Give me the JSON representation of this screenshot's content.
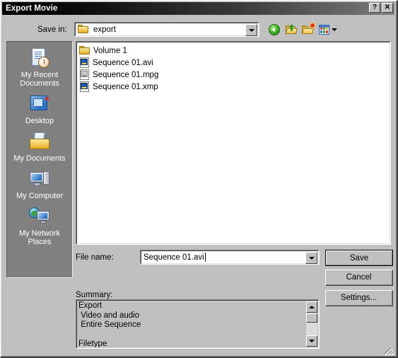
{
  "window": {
    "title": "Export Movie",
    "help_button": "?",
    "close_button": "✕"
  },
  "toolbar": {
    "savein_label": "Save in:",
    "savein_value": "export",
    "back_tooltip": "Back",
    "up_tooltip": "Up One Level",
    "new_folder_tooltip": "Create New Folder",
    "views_tooltip": "Views"
  },
  "places": {
    "items": [
      {
        "label": "My Recent\nDocuments",
        "icon": "recent-documents-icon"
      },
      {
        "label": "Desktop",
        "icon": "desktop-icon"
      },
      {
        "label": "My Documents",
        "icon": "my-documents-icon"
      },
      {
        "label": "My Computer",
        "icon": "my-computer-icon"
      },
      {
        "label": "My Network\nPlaces",
        "icon": "my-network-places-icon"
      }
    ]
  },
  "file_list": {
    "items": [
      {
        "name": "Volume 1",
        "type": "folder",
        "icon": "folder-icon"
      },
      {
        "name": "Sequence 01.avi",
        "type": "file",
        "icon": "media-file-icon"
      },
      {
        "name": "Sequence 01.mpg",
        "type": "file",
        "icon": "media-file-icon-gray"
      },
      {
        "name": "Sequence 01.xmp",
        "type": "file",
        "icon": "media-file-icon"
      }
    ]
  },
  "filename": {
    "label": "File name:",
    "value": "Sequence 01.avi"
  },
  "buttons": {
    "save": "Save",
    "cancel": "Cancel",
    "settings": "Settings..."
  },
  "summary": {
    "label": "Summary:",
    "text": "Export\n Video and audio\n Entire Sequence\n\nFiletype"
  },
  "colors": {
    "dialog_face": "#c0c0c0",
    "places_bar": "#808080",
    "titlebar_start": "#000000",
    "titlebar_end": "#828282",
    "list_background": "#ffffff",
    "text": "#000000",
    "places_text": "#ffffff"
  }
}
